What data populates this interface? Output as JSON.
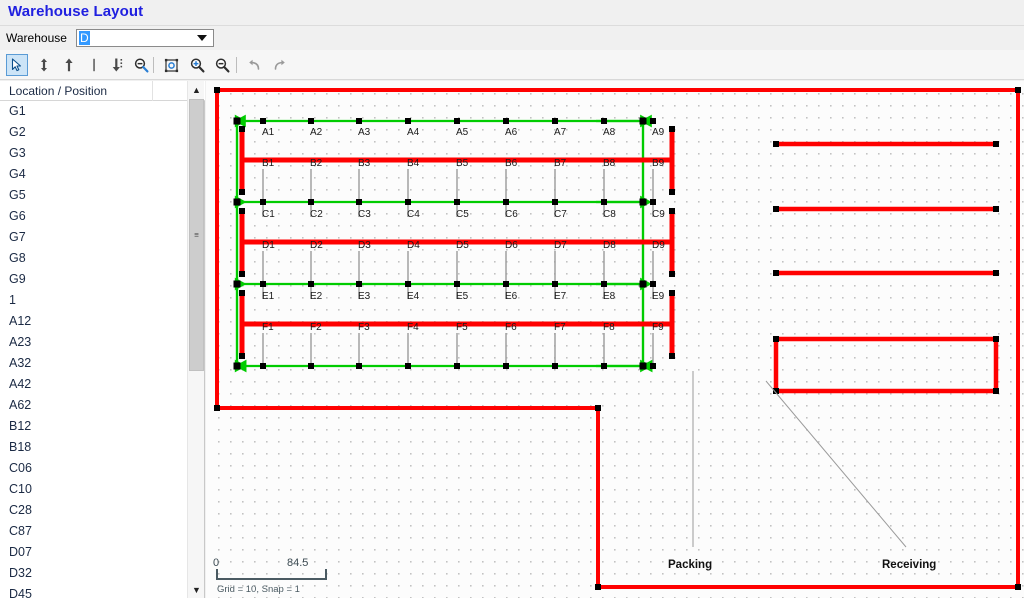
{
  "header": {
    "title": "Warehouse Layout"
  },
  "selector": {
    "label": "Warehouse",
    "value": "D",
    "arrow_icon": "chevron-down-icon"
  },
  "toolbar": {
    "buttons": [
      {
        "name": "select-tool",
        "icon": "cursor-arrow-icon",
        "active": true
      },
      {
        "name": "move-vertical-tool",
        "icon": "arrow-up-down-icon",
        "active": false
      },
      {
        "name": "move-up-tool",
        "icon": "arrow-up-icon",
        "active": false
      },
      {
        "name": "vertical-line-tool",
        "icon": "vertical-bar-icon",
        "active": false
      },
      {
        "name": "move-down-tool",
        "icon": "arrow-down-dotted-icon",
        "active": false
      },
      {
        "name": "zoom-out-region-tool",
        "icon": "magnifier-minus-icon",
        "active": false
      },
      {
        "name": "zoom-fit-tool",
        "icon": "zoom-to-fit-icon",
        "active": false
      },
      {
        "name": "zoom-in-tool",
        "icon": "magnifier-plus-icon",
        "active": false
      },
      {
        "name": "zoom-out-tool",
        "icon": "magnifier-minus-icon",
        "active": false
      },
      {
        "name": "undo-button",
        "icon": "undo-arrow-icon",
        "active": false
      },
      {
        "name": "redo-button",
        "icon": "redo-arrow-icon",
        "active": false
      }
    ]
  },
  "list": {
    "column_header": "Location / Position",
    "items": [
      "G1",
      "G2",
      "G3",
      "G4",
      "G5",
      "G6",
      "G7",
      "G8",
      "G9",
      "1",
      "A12",
      "A23",
      "A32",
      "A42",
      "A62",
      "B12",
      "B18",
      "C06",
      "C10",
      "C28",
      "C87",
      "D07",
      "D32",
      "D45"
    ],
    "scrollbar": {
      "up_icon": "chevron-up-icon",
      "down_icon": "chevron-down-icon",
      "grip_icon": "grip-lines-icon"
    }
  },
  "canvas": {
    "scale_bar": {
      "min": "0",
      "max": "84.5"
    },
    "grid_info": "Grid = 10, Snap = 1",
    "area_labels": [
      {
        "name": "packing-label",
        "text": "Packing"
      },
      {
        "name": "receiving-label",
        "text": "Receiving"
      }
    ],
    "colors": {
      "rack": "#ff0000",
      "path": "#00cc00",
      "node": "#000000",
      "grid_dot": "#bdbdbd",
      "leader": "#9a9a9a"
    },
    "rack_rows": [
      {
        "id": "A",
        "positions": [
          "A1",
          "A2",
          "A3",
          "A4",
          "A5",
          "A6",
          "A7",
          "A8",
          "A9"
        ]
      },
      {
        "id": "B",
        "positions": [
          "B1",
          "B2",
          "B3",
          "B4",
          "B5",
          "B6",
          "B7",
          "B8",
          "B9"
        ]
      },
      {
        "id": "C",
        "positions": [
          "C1",
          "C2",
          "C3",
          "C4",
          "C5",
          "C6",
          "C7",
          "C8",
          "C9"
        ]
      },
      {
        "id": "D",
        "positions": [
          "D1",
          "D2",
          "D3",
          "D4",
          "D5",
          "D6",
          "D7",
          "D8",
          "D9"
        ]
      },
      {
        "id": "E",
        "positions": [
          "E1",
          "E2",
          "E3",
          "E4",
          "E5",
          "E6",
          "E7",
          "E8",
          "E9"
        ]
      },
      {
        "id": "F",
        "positions": [
          "F1",
          "F2",
          "F3",
          "F4",
          "F5",
          "F6",
          "F7",
          "F8",
          "F9"
        ]
      }
    ],
    "dock_lines": 3,
    "staging_areas": 1
  }
}
